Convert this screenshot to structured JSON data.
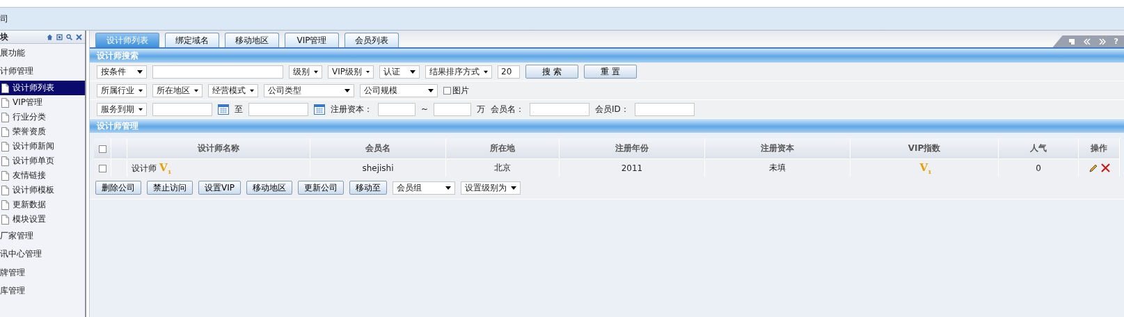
{
  "menu_bar": {
    "item": "司"
  },
  "sidebar": {
    "title": "块",
    "items": [
      {
        "label": "展功能",
        "kind": "group",
        "selected": false
      },
      {
        "label": "计师管理",
        "kind": "group",
        "selected": false
      },
      {
        "label": "设计师列表",
        "kind": "page",
        "selected": true
      },
      {
        "label": "VIP管理",
        "kind": "page",
        "selected": false
      },
      {
        "label": "行业分类",
        "kind": "page",
        "selected": false
      },
      {
        "label": "荣誉资质",
        "kind": "page",
        "selected": false
      },
      {
        "label": "设计师新闻",
        "kind": "page",
        "selected": false
      },
      {
        "label": "设计师单页",
        "kind": "page",
        "selected": false
      },
      {
        "label": "友情链接",
        "kind": "page",
        "selected": false
      },
      {
        "label": "设计师模板",
        "kind": "page",
        "selected": false
      },
      {
        "label": "更新数据",
        "kind": "page",
        "selected": false
      },
      {
        "label": "模块设置",
        "kind": "page",
        "selected": false
      },
      {
        "label": "厂家管理",
        "kind": "group",
        "selected": false
      },
      {
        "label": "讯中心管理",
        "kind": "group",
        "selected": false
      },
      {
        "label": "牌管理",
        "kind": "group",
        "selected": false
      },
      {
        "label": "库管理",
        "kind": "group",
        "selected": false
      }
    ]
  },
  "tabs": [
    {
      "label": "设计师列表",
      "selected": true
    },
    {
      "label": "绑定域名",
      "selected": false
    },
    {
      "label": "移动地区",
      "selected": false
    },
    {
      "label": "VIP管理",
      "selected": false
    },
    {
      "label": "会员列表",
      "selected": false
    }
  ],
  "tab_tools": {
    "help": "?"
  },
  "search": {
    "title": "设计师搜索",
    "lines": [
      {
        "fields": [
          {
            "kind": "select",
            "text": "按条件"
          },
          {
            "kind": "input"
          },
          {
            "kind": "select",
            "text": "级别"
          },
          {
            "kind": "select",
            "text": "VIP级别"
          },
          {
            "kind": "select",
            "text": "认证"
          },
          {
            "kind": "select",
            "text": "结果排序方式"
          },
          {
            "kind": "input",
            "text": "20"
          },
          {
            "kind": "button",
            "text": "搜 索"
          },
          {
            "kind": "button",
            "text": "重 置"
          }
        ]
      },
      {
        "fields": [
          {
            "kind": "select",
            "text": "所属行业"
          },
          {
            "kind": "select",
            "text": "所在地区"
          },
          {
            "kind": "select",
            "text": "经营模式"
          },
          {
            "kind": "select",
            "text": "公司类型"
          },
          {
            "kind": "select",
            "text": "公司规模"
          },
          {
            "kind": "checkbox",
            "text": "图片",
            "checked": false
          }
        ]
      },
      {
        "fields": [
          {
            "kind": "select",
            "text": "服务到期"
          },
          {
            "kind": "input"
          },
          {
            "kind": "calendar"
          },
          {
            "kind": "label",
            "text": "至"
          },
          {
            "kind": "input"
          },
          {
            "kind": "calendar"
          },
          {
            "kind": "label",
            "text": "注册资本："
          },
          {
            "kind": "input"
          },
          {
            "kind": "label",
            "text": "~"
          },
          {
            "kind": "input"
          },
          {
            "kind": "label",
            "text": "万"
          },
          {
            "kind": "label",
            "text": "会员名："
          },
          {
            "kind": "input"
          },
          {
            "kind": "label",
            "text": "会员ID："
          },
          {
            "kind": "input"
          }
        ]
      }
    ]
  },
  "table": {
    "title": "设计师管理",
    "all_checked": false,
    "columns": [
      "设计师名称",
      "会员名",
      "所在地",
      "注册年份",
      "注册资本",
      "VIP指数",
      "人气",
      "操作"
    ],
    "rows": [
      {
        "checked": false,
        "name": "设计师",
        "name_vip_mark": "V",
        "name_vip_grade": "1",
        "member": "shejishi",
        "location": "北京",
        "year": "2011",
        "capital": "未填",
        "vip_index_mark": "V",
        "vip_index_grade": "1",
        "popularity": "0"
      }
    ]
  },
  "actions": [
    {
      "kind": "button",
      "text": "删除公司"
    },
    {
      "kind": "button",
      "text": "禁止访问"
    },
    {
      "kind": "button",
      "text": "设置VIP"
    },
    {
      "kind": "button",
      "text": "移动地区"
    },
    {
      "kind": "button",
      "text": "更新公司"
    },
    {
      "kind": "button",
      "text": "移动至"
    },
    {
      "kind": "select",
      "text": "会员组"
    },
    {
      "kind": "select",
      "text": "设置级别为"
    }
  ]
}
